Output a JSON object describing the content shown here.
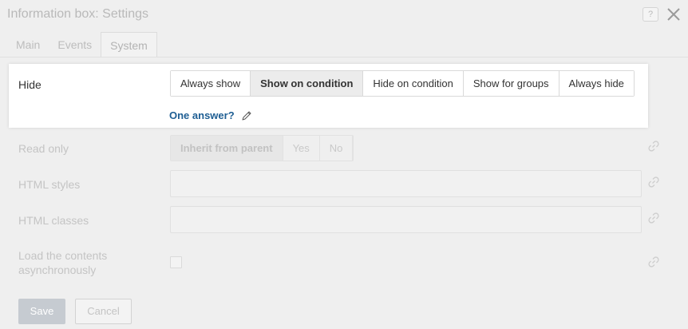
{
  "dialog": {
    "title": "Information box: Settings",
    "help_label": "?",
    "close_icon": "close-icon"
  },
  "tabs": [
    {
      "label": "Main",
      "active": false
    },
    {
      "label": "Events",
      "active": false
    },
    {
      "label": "System",
      "active": true
    }
  ],
  "hide_setting": {
    "label": "Hide",
    "options": [
      "Always show",
      "Show on condition",
      "Hide on condition",
      "Show for groups",
      "Always hide"
    ],
    "selected": "Show on condition",
    "condition_link": "One answer?",
    "edit_icon": "pencil-icon"
  },
  "read_only": {
    "label": "Read only",
    "options": [
      "Inherit from parent",
      "Yes",
      "No"
    ],
    "selected": "Inherit from parent"
  },
  "html_styles": {
    "label": "HTML styles",
    "value": ""
  },
  "html_classes": {
    "label": "HTML classes",
    "value": ""
  },
  "load_async": {
    "label_line1": "Load the contents",
    "label_line2": "asynchronously",
    "checked": false
  },
  "link_icon": "link-icon",
  "footer": {
    "save_label": "Save",
    "cancel_label": "Cancel"
  },
  "colors": {
    "accent_link": "#1e5e93",
    "selected_segment": "#ececec",
    "save_disabled": "#c6cbd1"
  }
}
